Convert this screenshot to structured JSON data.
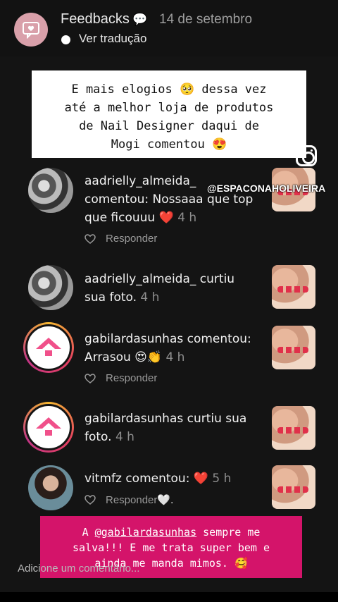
{
  "header": {
    "name": "Feedbacks",
    "bubble": "💬",
    "date": "14 de setembro",
    "translate": "Ver tradução"
  },
  "caption": {
    "line1": "E mais elogios 🥺 dessa vez",
    "line2": "até a melhor loja de produtos",
    "line3": "de Nail Designer daqui de",
    "line4": "Mogi comentou 😍"
  },
  "watermark": "@ESPACONAHOLIVEIRA",
  "notifications": [
    {
      "line1": "aadrielly_almeida_",
      "line2": "comentou: Nossaaa que top",
      "line3a": "que ficouuu ",
      "heart": "❤️",
      "time": " 4 h",
      "reply": "Responder"
    },
    {
      "line1": "aadrielly_almeida_ curtiu",
      "line2a": "sua foto.",
      "time": " 4 h"
    },
    {
      "line1": "gabilardasunhas comentou:",
      "line2a": "Arrasou 😍👏",
      "time": " 4 h",
      "reply": "Responder"
    },
    {
      "line1": "gabilardasunhas curtiu sua",
      "line2a": "foto.",
      "time": " 4 h"
    },
    {
      "line1a": "vitmfz comentou: ",
      "heart": "❤️",
      "time": " 5 h",
      "reply": "Responder",
      "reply_suffix": "🤍."
    }
  ],
  "pink_caption": {
    "line1a": "A ",
    "mention": "@gabilardasunhas",
    "line1b": " sempre me",
    "line2": "salva!!! E me trata super bem e",
    "line3": "ainda me manda mimos. 🥰"
  },
  "comment_placeholder": "Adicione um comentário..."
}
